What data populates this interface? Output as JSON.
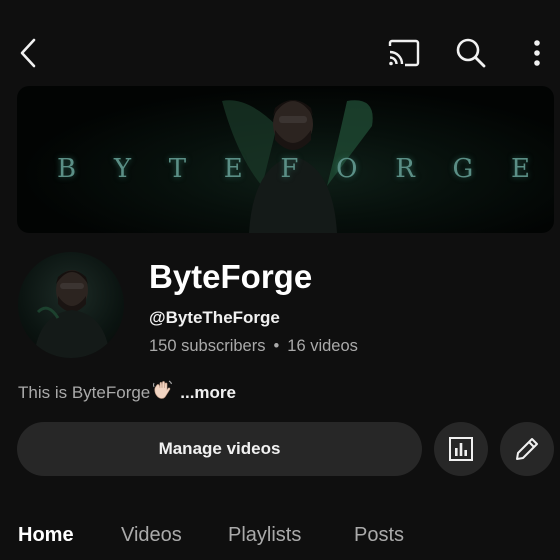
{
  "topbar": {
    "back_icon": "chevron-left-icon",
    "cast_icon": "cast-icon",
    "search_icon": "search-icon",
    "more_icon": "more-vert-icon"
  },
  "banner": {
    "letters": [
      "B",
      "Y",
      "T",
      "E",
      "F",
      "O",
      "R",
      "G",
      "E"
    ]
  },
  "channel": {
    "name": "ByteForge",
    "handle": "@ByteTheForge",
    "subscribers": "150 subscribers",
    "separator": "•",
    "videos": "16 videos",
    "description": "This is ByteForge",
    "description_emoji": "waving-hand-icon",
    "more_label": "...more"
  },
  "actions": {
    "manage_label": "Manage videos",
    "analytics_icon": "analytics-icon",
    "edit_icon": "pencil-icon"
  },
  "tabs": [
    {
      "label": "Home",
      "active": true
    },
    {
      "label": "Videos",
      "active": false
    },
    {
      "label": "Playlists",
      "active": false
    },
    {
      "label": "Posts",
      "active": false
    }
  ],
  "colors": {
    "background": "#0f0f0f",
    "button_bg": "#272727",
    "text_primary": "#f1f1f1",
    "text_secondary": "#aaaaaa",
    "banner_text": "#5b8f86"
  }
}
